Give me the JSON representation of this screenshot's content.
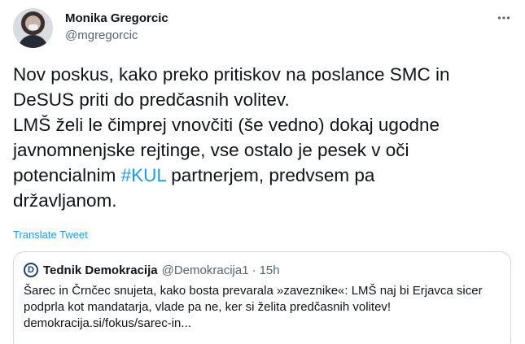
{
  "author": {
    "name": "Monika Gregorcic",
    "handle": "@mgregorcic",
    "more_icon": "more-horizontal-icon"
  },
  "tweet": {
    "lines": [
      "Nov poskus, kako preko pritiskov na poslance SMC in",
      "DeSUS priti do predčasnih volitev.",
      "LMŠ želi le čimprej vnovčiti (še vedno) dokaj ugodne",
      "javnomnenjske rejtinge, vse ostalo je pesek v oči",
      "potencialnim ",
      "#KUL",
      " partnerjem, predvsem pa",
      "državljanom."
    ],
    "translate_label": "Translate Tweet"
  },
  "quote": {
    "logo_letter": "D",
    "name": "Tednik Demokracija",
    "handle": "@Demokracija1",
    "separator": "·",
    "time": "15h",
    "lines": [
      "Šarec in Črnčec snujeta, kako bosta prevarala »zaveznike«: LMŠ naj bi Erjavca sicer",
      "podprla kot mandatarja, vlade pa ne, ker si želita predčasnih volitev!",
      "demokracija.si/fokus/sarec-in..."
    ]
  },
  "colors": {
    "link": "#1d9bf0",
    "muted": "#536471",
    "text": "#0f1419",
    "border": "#cfd9de"
  }
}
